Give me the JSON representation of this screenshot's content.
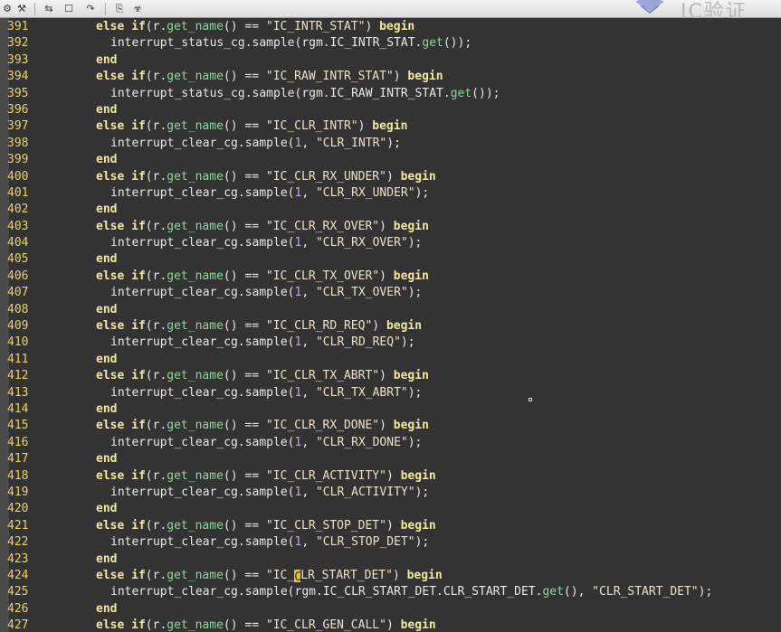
{
  "toolbar": {
    "buttons": [
      {
        "name": "build-icon",
        "glyph": "⚙"
      },
      {
        "name": "settings-icon",
        "glyph": "⚒"
      },
      {
        "name": "compare-icon",
        "glyph": "⇆"
      },
      {
        "name": "window-icon",
        "glyph": "☐"
      },
      {
        "name": "redo-icon",
        "glyph": "↷"
      },
      {
        "name": "bookmark-icon",
        "glyph": "⎘"
      },
      {
        "name": "debug-icon",
        "glyph": "☣"
      }
    ],
    "watermark_logo": "logo-mark-icon",
    "watermark_text": "IC验证"
  },
  "colors": {
    "background": "#333333",
    "line_number": "#f0d060",
    "keyword": "#f2e6a0",
    "method": "#8fd49a",
    "string": "#ece0c8",
    "number": "#c8a0e8"
  },
  "lines": [
    {
      "n": "391",
      "kind": "if",
      "reg": "IC_INTR_STAT"
    },
    {
      "n": "392",
      "kind": "sample_rgm",
      "cg": "interrupt_status_cg",
      "field": "IC_INTR_STAT"
    },
    {
      "n": "393",
      "kind": "end"
    },
    {
      "n": "394",
      "kind": "if",
      "reg": "IC_RAW_INTR_STAT"
    },
    {
      "n": "395",
      "kind": "sample_rgm",
      "cg": "interrupt_status_cg",
      "field": "IC_RAW_INTR_STAT"
    },
    {
      "n": "396",
      "kind": "end"
    },
    {
      "n": "397",
      "kind": "if",
      "reg": "IC_CLR_INTR"
    },
    {
      "n": "398",
      "kind": "sample_one",
      "cg": "interrupt_clear_cg",
      "arg": "CLR_INTR"
    },
    {
      "n": "399",
      "kind": "end"
    },
    {
      "n": "400",
      "kind": "if",
      "reg": "IC_CLR_RX_UNDER"
    },
    {
      "n": "401",
      "kind": "sample_one",
      "cg": "interrupt_clear_cg",
      "arg": "CLR_RX_UNDER"
    },
    {
      "n": "402",
      "kind": "end"
    },
    {
      "n": "403",
      "kind": "if",
      "reg": "IC_CLR_RX_OVER"
    },
    {
      "n": "404",
      "kind": "sample_one",
      "cg": "interrupt_clear_cg",
      "arg": "CLR_RX_OVER"
    },
    {
      "n": "405",
      "kind": "end"
    },
    {
      "n": "406",
      "kind": "if",
      "reg": "IC_CLR_TX_OVER"
    },
    {
      "n": "407",
      "kind": "sample_one",
      "cg": "interrupt_clear_cg",
      "arg": "CLR_TX_OVER"
    },
    {
      "n": "408",
      "kind": "end"
    },
    {
      "n": "409",
      "kind": "if",
      "reg": "IC_CLR_RD_REQ"
    },
    {
      "n": "410",
      "kind": "sample_one",
      "cg": "interrupt_clear_cg",
      "arg": "CLR_RD_REQ"
    },
    {
      "n": "411",
      "kind": "end"
    },
    {
      "n": "412",
      "kind": "if",
      "reg": "IC_CLR_TX_ABRT"
    },
    {
      "n": "413",
      "kind": "sample_one",
      "cg": "interrupt_clear_cg",
      "arg": "CLR_TX_ABRT"
    },
    {
      "n": "414",
      "kind": "end"
    },
    {
      "n": "415",
      "kind": "if",
      "reg": "IC_CLR_RX_DONE"
    },
    {
      "n": "416",
      "kind": "sample_one",
      "cg": "interrupt_clear_cg",
      "arg": "CLR_RX_DONE"
    },
    {
      "n": "417",
      "kind": "end"
    },
    {
      "n": "418",
      "kind": "if",
      "reg": "IC_CLR_ACTIVITY"
    },
    {
      "n": "419",
      "kind": "sample_one",
      "cg": "interrupt_clear_cg",
      "arg": "CLR_ACTIVITY"
    },
    {
      "n": "420",
      "kind": "end"
    },
    {
      "n": "421",
      "kind": "if",
      "reg": "IC_CLR_STOP_DET"
    },
    {
      "n": "422",
      "kind": "sample_one",
      "cg": "interrupt_clear_cg",
      "arg": "CLR_STOP_DET"
    },
    {
      "n": "423",
      "kind": "end"
    },
    {
      "n": "424",
      "kind": "if_cursor",
      "reg_before": "IC_",
      "reg_cursor": "C",
      "reg_after": "LR_START_DET"
    },
    {
      "n": "425",
      "kind": "sample_rgm_named",
      "cg": "interrupt_clear_cg",
      "field": "IC_CLR_START_DET.CLR_START_DET",
      "arg": "CLR_START_DET"
    },
    {
      "n": "426",
      "kind": "end"
    },
    {
      "n": "427",
      "kind": "if",
      "reg": "IC_CLR_GEN_CALL"
    }
  ]
}
